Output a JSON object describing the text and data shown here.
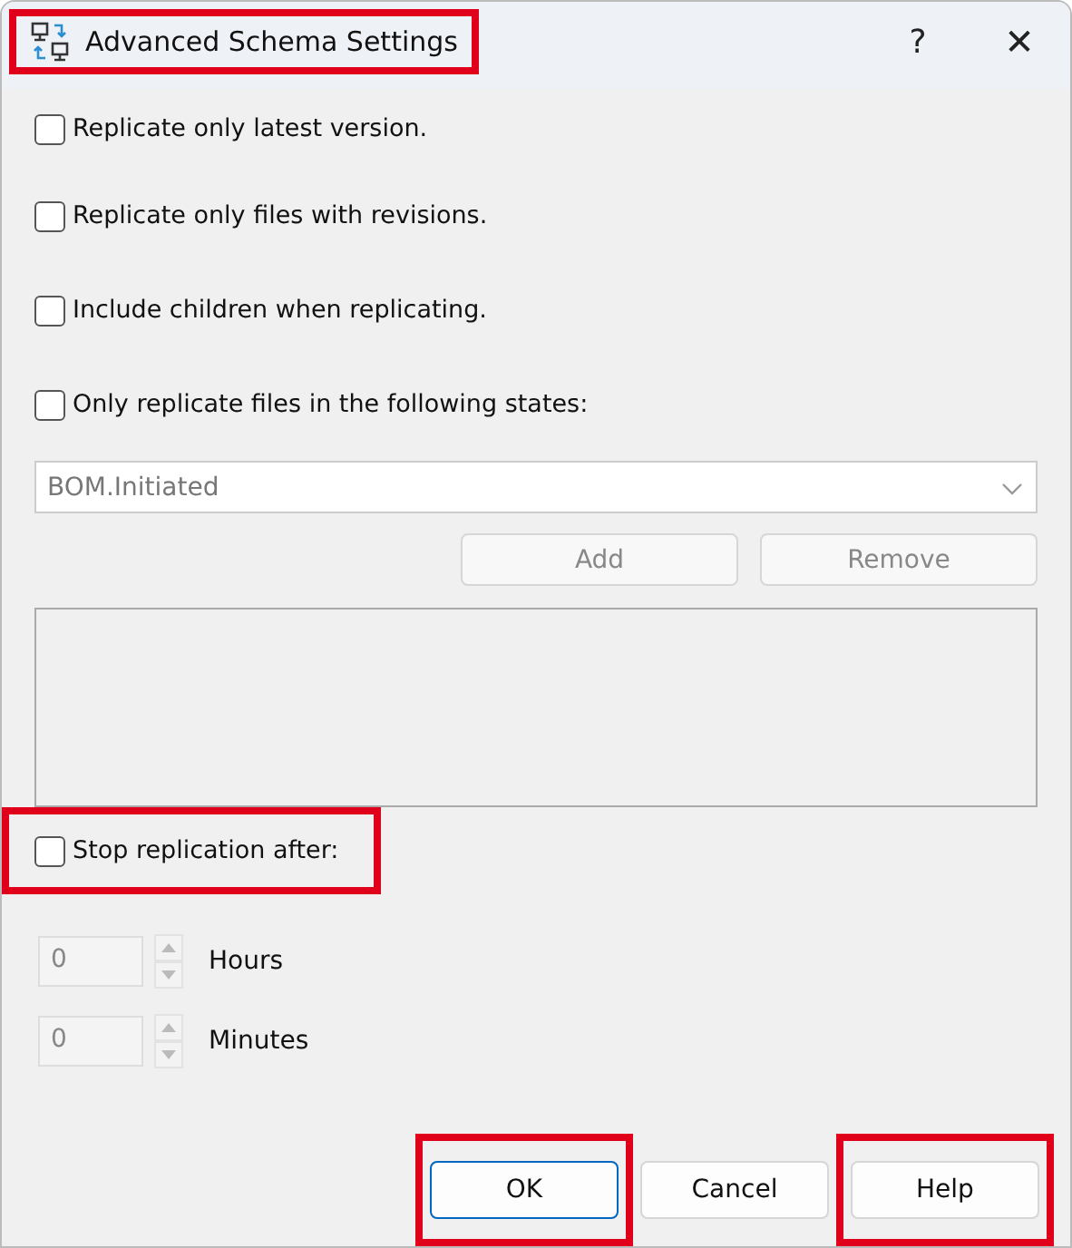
{
  "window": {
    "title": "Advanced Schema Settings",
    "title_highlighted": true,
    "help_glyph": "?",
    "close_glyph": "✕"
  },
  "options": [
    {
      "label": "Replicate only latest version.",
      "checked": false
    },
    {
      "label": "Replicate only files with revisions.",
      "checked": false
    },
    {
      "label": "Include children when replicating.",
      "checked": false
    },
    {
      "label": "Only replicate files in the following states:",
      "checked": false
    }
  ],
  "state_combo": {
    "value": "BOM.Initiated",
    "disabled": true
  },
  "state_buttons": [
    {
      "label": "Add",
      "disabled": true
    },
    {
      "label": "Remove",
      "disabled": true
    }
  ],
  "stop_replication": {
    "label": "Stop replication after:",
    "checked": false,
    "highlighted": true
  },
  "spinners": [
    {
      "value": "0",
      "unit": "Hours",
      "disabled": true
    },
    {
      "value": "0",
      "unit": "Minutes",
      "disabled": true
    }
  ],
  "buttons": [
    {
      "label": "OK",
      "default": true,
      "highlighted": true
    },
    {
      "label": "Cancel",
      "default": false,
      "highlighted": false
    },
    {
      "label": "Help",
      "default": false,
      "highlighted": true
    }
  ]
}
